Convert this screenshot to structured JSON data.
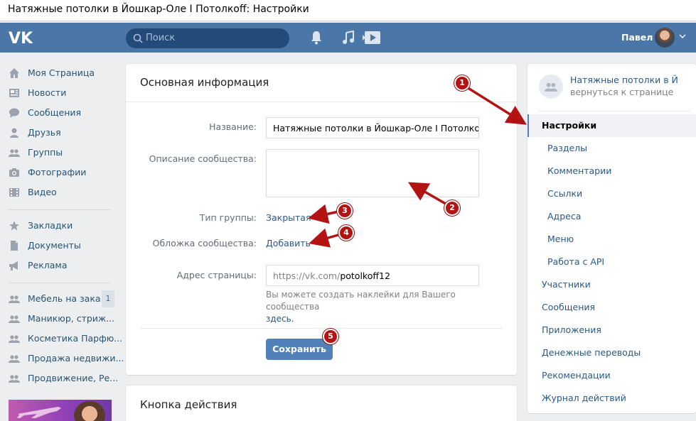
{
  "window": {
    "title": "Натяжные потолки в Йошкар-Оле I Потолкoff: Настройки"
  },
  "header": {
    "logo": "vk-logo",
    "search_placeholder": "Поиск",
    "user_name": "Павел"
  },
  "left_nav": {
    "main": [
      {
        "label": "Моя Страница",
        "icon": "home-icon"
      },
      {
        "label": "Новости",
        "icon": "news-icon"
      },
      {
        "label": "Сообщения",
        "icon": "messages-icon"
      },
      {
        "label": "Друзья",
        "icon": "friends-icon"
      },
      {
        "label": "Группы",
        "icon": "groups-icon"
      },
      {
        "label": "Фотографии",
        "icon": "photos-icon"
      },
      {
        "label": "Видео",
        "icon": "video-icon"
      }
    ],
    "secondary": [
      {
        "label": "Закладки",
        "icon": "bookmarks-icon"
      },
      {
        "label": "Документы",
        "icon": "documents-icon"
      },
      {
        "label": "Реклама",
        "icon": "ads-icon"
      }
    ],
    "groups": [
      {
        "label": "Мебель на зака...",
        "badge": "1"
      },
      {
        "label": "Маникюр, стриж..."
      },
      {
        "label": "Косметика Парфю..."
      },
      {
        "label": "Продажа недвижи..."
      },
      {
        "label": "Продвижение, Ре..."
      }
    ]
  },
  "main_card": {
    "title": "Основная информация",
    "fields": {
      "name_label": "Название:",
      "name_value": "Натяжные потолки в Йошкар-Оле I Потолкoff",
      "description_label": "Описание сообщества:",
      "description_value": "",
      "type_label": "Тип группы:",
      "type_value": "Закрытая",
      "cover_label": "Обложка сообщества:",
      "cover_value": "Добавить",
      "address_label": "Адрес страницы:",
      "address_prefix": "https://vk.com/",
      "address_value": "potolkoff12",
      "hint_text": "Вы можете создать наклейки для Вашего сообщества",
      "hint_link": "здесь."
    },
    "save_button": "Сохранить"
  },
  "second_card": {
    "title": "Кнопка действия"
  },
  "right_menu": {
    "community_name": "Натяжные потолки в Йош...",
    "back_link": "вернуться к странице",
    "items": [
      {
        "label": "Настройки",
        "active": true,
        "sub": false
      },
      {
        "label": "Разделы",
        "sub": true
      },
      {
        "label": "Комментарии",
        "sub": true
      },
      {
        "label": "Ссылки",
        "sub": true
      },
      {
        "label": "Адреса",
        "sub": true
      },
      {
        "label": "Меню",
        "sub": true
      },
      {
        "label": "Работа с API",
        "sub": true
      },
      {
        "label": "Участники",
        "sub": false
      },
      {
        "label": "Сообщения",
        "sub": false
      },
      {
        "label": "Приложения",
        "sub": false
      },
      {
        "label": "Денежные переводы",
        "sub": false
      },
      {
        "label": "Рекомендации",
        "sub": false
      },
      {
        "label": "Журнал действий",
        "sub": false
      }
    ]
  },
  "annotations": [
    "1",
    "2",
    "3",
    "4",
    "5"
  ],
  "colors": {
    "header": "#4a76a8",
    "accent": "#5181b8",
    "link": "#2a5885",
    "marker": "#b31313"
  }
}
